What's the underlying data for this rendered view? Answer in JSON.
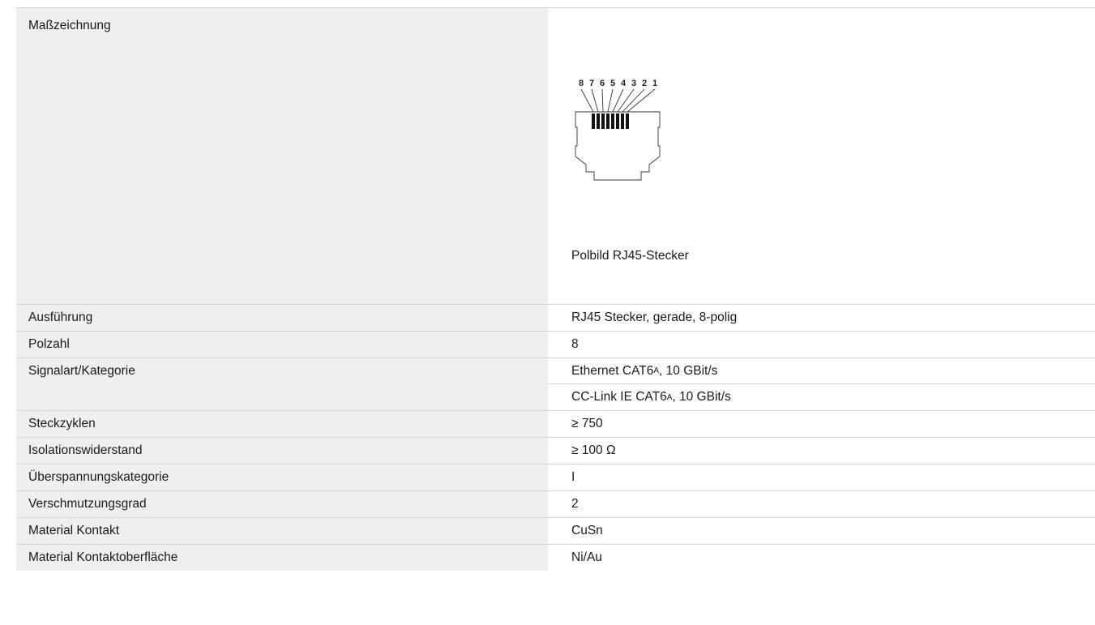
{
  "drawing": {
    "label": "Maßzeichnung",
    "pin_numbers": [
      "8",
      "7",
      "6",
      "5",
      "4",
      "3",
      "2",
      "1"
    ],
    "caption": "Polbild RJ45-Stecker"
  },
  "rows": [
    {
      "label": "Ausführung",
      "value": "RJ45 Stecker, gerade, 8-polig"
    },
    {
      "label": "Polzahl",
      "value": "8"
    },
    {
      "label": "Signalart/Kategorie",
      "values": [
        {
          "pre": "Ethernet CAT6",
          "sub": "A",
          "post": ", 10 GBit/s"
        },
        {
          "pre": "CC-Link IE CAT6",
          "sub": "A",
          "post": ", 10 GBit/s"
        }
      ]
    },
    {
      "label": "Steckzyklen",
      "value": "≥ 750"
    },
    {
      "label": "Isolationswiderstand",
      "value": "≥ 100 Ω"
    },
    {
      "label": "Überspannungskategorie",
      "value": "I"
    },
    {
      "label": "Verschmutzungsgrad",
      "value": "2"
    },
    {
      "label": "Material Kontakt",
      "value": "CuSn"
    },
    {
      "label": "Material Kontaktoberfläche",
      "value": "Ni/Au"
    }
  ]
}
